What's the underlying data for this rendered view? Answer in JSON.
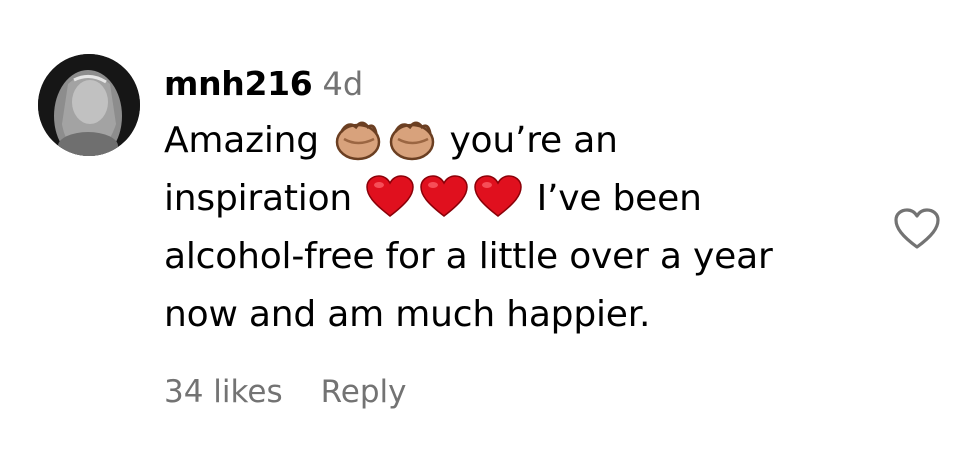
{
  "comment": {
    "username": "mnh216",
    "timestamp": "4d",
    "text_lines": [
      {
        "before": "Amazing",
        "emoji": [
          "clapping-hands-icon",
          "clapping-hands-icon"
        ],
        "after": "you’re an"
      },
      {
        "before": "inspiration",
        "emoji": [
          "red-heart-icon",
          "red-heart-icon",
          "red-heart-icon"
        ],
        "after": "I’ve been"
      },
      {
        "text": "alcohol-free for a little over a year"
      },
      {
        "text": "now and am much happier."
      }
    ],
    "likes_label": "34 likes",
    "reply_label": "Reply",
    "like_icon": "heart-outline-icon",
    "colors": {
      "secondary_text": "#737373",
      "heart_red": "#e0101e",
      "clap_skin": "#d8a27c"
    }
  }
}
